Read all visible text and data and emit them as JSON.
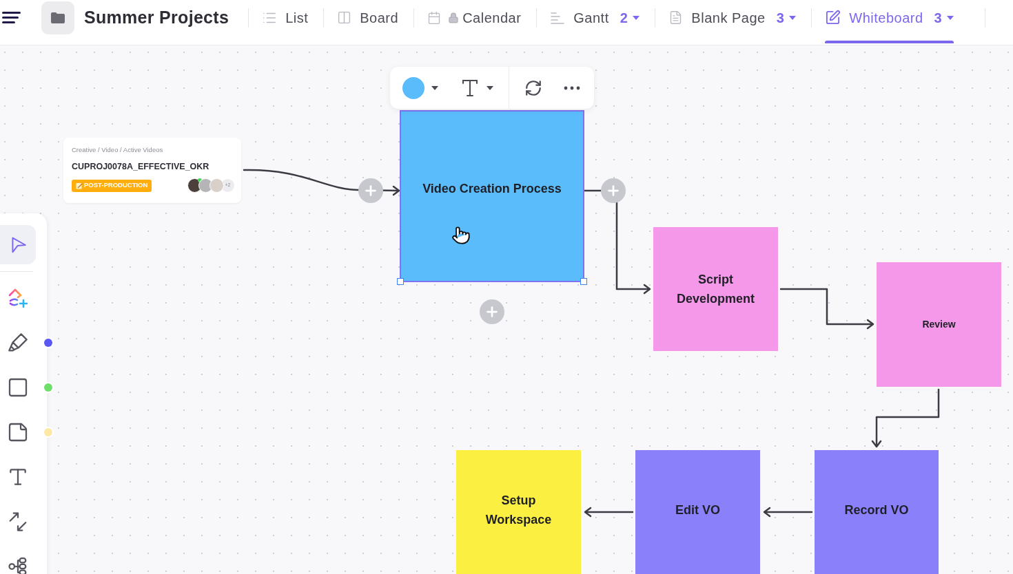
{
  "header": {
    "title": "Summer Projects",
    "views": [
      {
        "label": "List",
        "kind": "list",
        "locked": false,
        "selected": false
      },
      {
        "label": "Board",
        "kind": "board",
        "locked": false,
        "selected": false
      },
      {
        "label": "Calendar",
        "kind": "calendar",
        "locked": true,
        "selected": false
      },
      {
        "label": "Gantt",
        "kind": "gantt",
        "locked": false,
        "count": "2",
        "selected": false
      },
      {
        "label": "Blank Page",
        "kind": "doc",
        "locked": false,
        "count": "3",
        "selected": false
      },
      {
        "label": "Whiteboard",
        "kind": "whiteboard",
        "locked": false,
        "count": "3",
        "selected": true
      }
    ]
  },
  "tools": [
    {
      "kind": "select",
      "selected": true
    },
    {
      "kind": "ai",
      "selected": false
    },
    {
      "kind": "pen",
      "selected": false,
      "color": "#5b57f5"
    },
    {
      "kind": "shape",
      "selected": false,
      "color": "#6ddf6a"
    },
    {
      "kind": "sticky",
      "selected": false,
      "color": "#fde8a6"
    },
    {
      "kind": "text",
      "selected": false
    },
    {
      "kind": "connector",
      "selected": false
    },
    {
      "kind": "mindmap",
      "selected": false
    }
  ],
  "canvas": {
    "task_card": {
      "breadcrumb": "Creative / Video / Active Videos",
      "title": "CUPROJ0078A_EFFECTIVE_OKR",
      "status": "POST-PRODUCTION",
      "avatars": [
        {
          "online": true
        },
        {
          "online": false
        },
        {
          "online": false
        }
      ],
      "more_assignees": "+2"
    },
    "nodes": [
      {
        "label": "Video Creation Process",
        "color": "#5bbcfb",
        "selected": true
      },
      {
        "label": "Script Development",
        "color": "#f698ea",
        "selected": false
      },
      {
        "label": "Review",
        "color": "#f698ea",
        "selected": false
      },
      {
        "label": "Setup Workspace",
        "color": "#fbf042",
        "selected": false
      },
      {
        "label": "Edit VO",
        "color": "#8a80fa",
        "selected": false
      },
      {
        "label": "Record VO",
        "color": "#8a80fa",
        "selected": false
      }
    ]
  }
}
